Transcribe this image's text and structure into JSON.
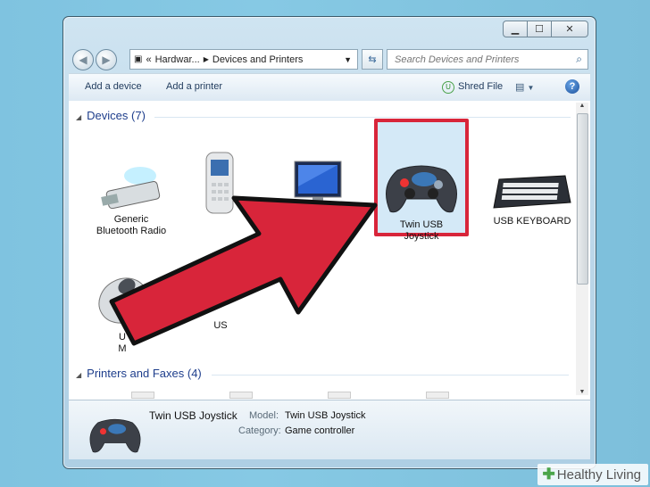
{
  "window": {
    "address": {
      "back": "«",
      "segments": [
        "Hardwar...",
        "Devices and Printers"
      ]
    },
    "search": {
      "placeholder": "Search Devices and Printers"
    }
  },
  "commandbar": {
    "add_device": "Add a device",
    "add_printer": "Add a printer",
    "shred_file": "Shred File"
  },
  "groups": {
    "devices": {
      "label": "Devices (7)"
    },
    "printers": {
      "label": "Printers and Faxes (4)"
    }
  },
  "devices": [
    {
      "label1": "Generic",
      "label2": "Bluetooth Radio",
      "icon": "usb-bluetooth-icon"
    },
    {
      "label1": "",
      "label2": "",
      "icon": "phone-icon"
    },
    {
      "label1": "",
      "label2": "",
      "icon": "monitor-icon"
    },
    {
      "label1": "Twin USB",
      "label2": "Joystick",
      "icon": "gamepad-icon",
      "selected": true
    },
    {
      "label1": "USB KEYBOARD",
      "label2": "",
      "icon": "keyboard-icon"
    }
  ],
  "devices_row2": [
    {
      "label1": "U",
      "label2": "M",
      "icon": "mouse-icon"
    },
    {
      "label1": "US",
      "label2": "",
      "icon": "usb-device-icon"
    }
  ],
  "details": {
    "name": "Twin USB Joystick",
    "model_key": "Model:",
    "model": "Twin USB Joystick",
    "category_key": "Category:",
    "category": "Game controller"
  },
  "watermark": {
    "mark": "✚",
    "text": "Healthy Living"
  },
  "colors": {
    "highlight": "#d8253a",
    "arrow": "#d8253a"
  }
}
